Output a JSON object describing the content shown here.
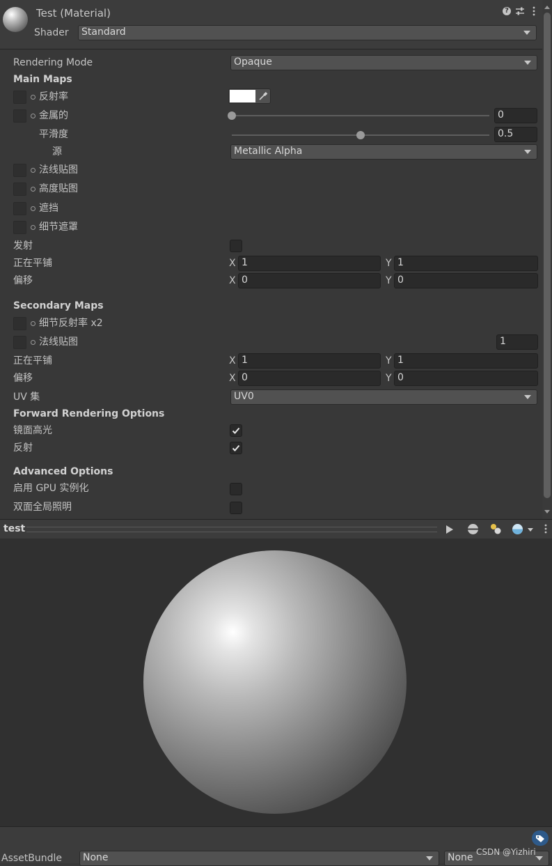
{
  "header": {
    "title": "Test (Material)",
    "shader_label": "Shader",
    "shader_value": "Standard"
  },
  "rendering_mode": {
    "label": "Rendering Mode",
    "value": "Opaque"
  },
  "main_maps": {
    "heading": "Main Maps",
    "albedo_label": "反射率",
    "albedo_color": "#ffffff",
    "metallic_label": "金属的",
    "metallic_value": "0",
    "metallic_fraction": 0,
    "smoothness_label": "平滑度",
    "smoothness_value": "0.5",
    "smoothness_fraction": 0.5,
    "source_label": "源",
    "source_value": "Metallic Alpha",
    "normal_label": "法线贴图",
    "height_label": "高度贴图",
    "occlusion_label": "遮挡",
    "detail_mask_label": "细节遮罩",
    "emission_label": "发射",
    "tiling_label": "正在平铺",
    "tiling_x": "1",
    "tiling_y": "1",
    "offset_label": "偏移",
    "offset_x": "0",
    "offset_y": "0",
    "x_label": "X",
    "y_label": "Y"
  },
  "secondary_maps": {
    "heading": "Secondary Maps",
    "detail_albedo_label": "细节反射率 x2",
    "normal_label": "法线贴图",
    "normal_scale": "1",
    "tiling_label": "正在平铺",
    "tiling_x": "1",
    "tiling_y": "1",
    "offset_label": "偏移",
    "offset_x": "0",
    "offset_y": "0",
    "uv_label": "UV 集",
    "uv_value": "UV0"
  },
  "forward_options": {
    "heading": "Forward Rendering Options",
    "specular_label": "镜面高光",
    "specular_checked": true,
    "reflections_label": "反射",
    "reflections_checked": true
  },
  "advanced_options": {
    "heading": "Advanced Options",
    "gpu_instancing_label": "启用 GPU 实例化",
    "gpu_instancing_checked": false,
    "double_sided_gi_label": "双面全局照明",
    "double_sided_gi_checked": false
  },
  "preview": {
    "title": "test"
  },
  "footer": {
    "assetbundle_label": "AssetBundle",
    "bundle_value": "None",
    "variant_value": "None",
    "watermark": "CSDN @Yizhiri_"
  },
  "icons": [
    "material-sphere-icon",
    "help-icon",
    "preset-icon",
    "more-icon",
    "play-icon",
    "preview-sphere-icon",
    "light-icon",
    "skybox-icon",
    "asset-label-icon",
    "object-picker-icon",
    "eyedropper-icon",
    "checkmark-icon"
  ],
  "colors": {
    "panel": "#383838",
    "field": "#2a2a2a",
    "dropdown": "#515151",
    "preview_bg": "#303030"
  }
}
